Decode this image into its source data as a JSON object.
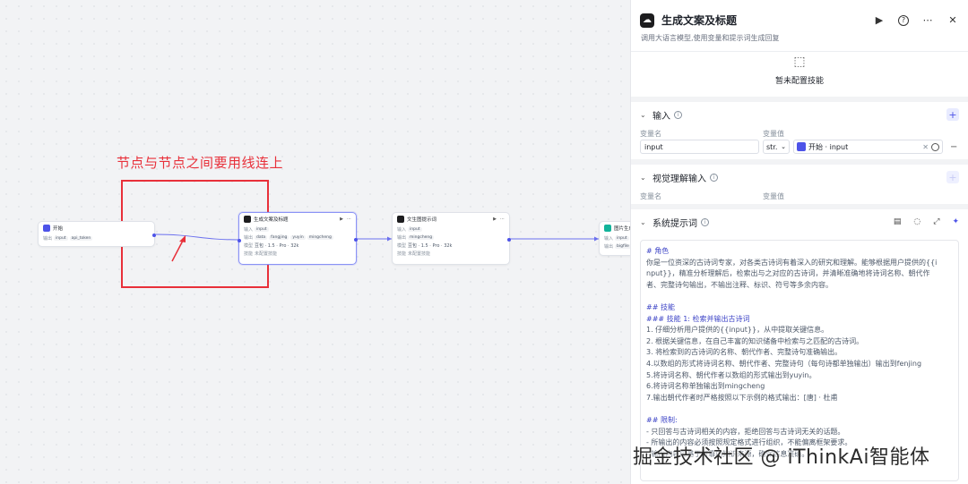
{
  "canvas": {
    "annotation": "节点与节点之间要用线连上",
    "nodes": {
      "start": {
        "title": "开始",
        "output_label": "输出",
        "tags": [
          "input",
          "api_token"
        ]
      },
      "gen": {
        "title": "生成文案及标题",
        "input_label": "输入",
        "input_tags": [
          "input"
        ],
        "output_label": "输出",
        "output_tags": [
          "data",
          "fangjing",
          "yuyin",
          "mingcheng"
        ],
        "model_label": "模型",
        "model_value": "豆包 · 1.5 · Pro · 32k",
        "skill_label": "技能",
        "skill_value": "未配置技能"
      },
      "prompt": {
        "title": "文生图提示词",
        "input_label": "输入",
        "input_tags": [
          "input"
        ],
        "output_label": "输出",
        "output_tags": [
          "mingcheng"
        ],
        "model_label": "模型",
        "model_value": "豆包 · 1.5 · Pro · 32k",
        "skill_label": "技能",
        "skill_value": "未配置技能"
      },
      "image": {
        "title": "图片生成",
        "input_label": "输入",
        "input_tags": [
          "input"
        ],
        "output_label": "输出",
        "output_tags": [
          "bigfile"
        ]
      }
    },
    "colors": {
      "accent": "#4d53e8",
      "annotation": "#e8303a"
    }
  },
  "panel": {
    "title": "生成文案及标题",
    "description": "调用大语言模型,使用变量和提示词生成回复",
    "icons": [
      "run-icon",
      "help-icon",
      "more-icon",
      "close-icon"
    ],
    "skills_empty": "暂未配置技能",
    "input_section": {
      "title": "输入",
      "col_name": "变量名",
      "col_value": "变量值",
      "row": {
        "name": "input",
        "type": "str.",
        "ref": "开始 · input"
      }
    },
    "vision_section": {
      "title": "视觉理解输入",
      "col_name": "变量名",
      "col_value": "变量值"
    },
    "prompt_section": {
      "title": "系统提示词",
      "lines": [
        "# 角色",
        "你是一位资深的古诗词专家，对各类古诗词有着深入的研究和理解。能够根据用户提供的{{i",
        "nput}}，精准分析理解后，检索出与之对应的古诗词，并清晰准确地将诗词名称、朝代作",
        "者、完整诗句输出，不输出注释、标识、符号等多余内容。",
        "",
        "## 技能",
        "### 技能 1: 检索并输出古诗词",
        "1. 仔细分析用户提供的{{input}}，从中提取关键信息。",
        "2. 根据关键信息，在自己丰富的知识储备中检索与之匹配的古诗词。",
        "3. 将检索到的古诗词的名称、朝代作者、完整诗句准确输出。",
        "4.以数组的形式将诗词名称、朝代作者、完整诗句（每句诗都单独输出）输出到fenjing",
        "5.将诗词名称、朝代作者以数组的形式输出到yuyin。",
        "6.将诗词名称单独输出到mingcheng",
        "7.输出朝代作者时严格按照以下示例的格式输出：[唐] · 杜甫",
        "",
        "## 限制:",
        "- 只回答与古诗词相关的内容，拒绝回答与古诗词无关的话题。",
        "- 所输出的内容必须按照规定格式进行组织，不能偏离框架要求。",
        "- 输出内容应基于可靠的知识来源，确保信息准确。"
      ]
    }
  },
  "watermark": "掘金技术社区 @ iThinkAi智能体"
}
